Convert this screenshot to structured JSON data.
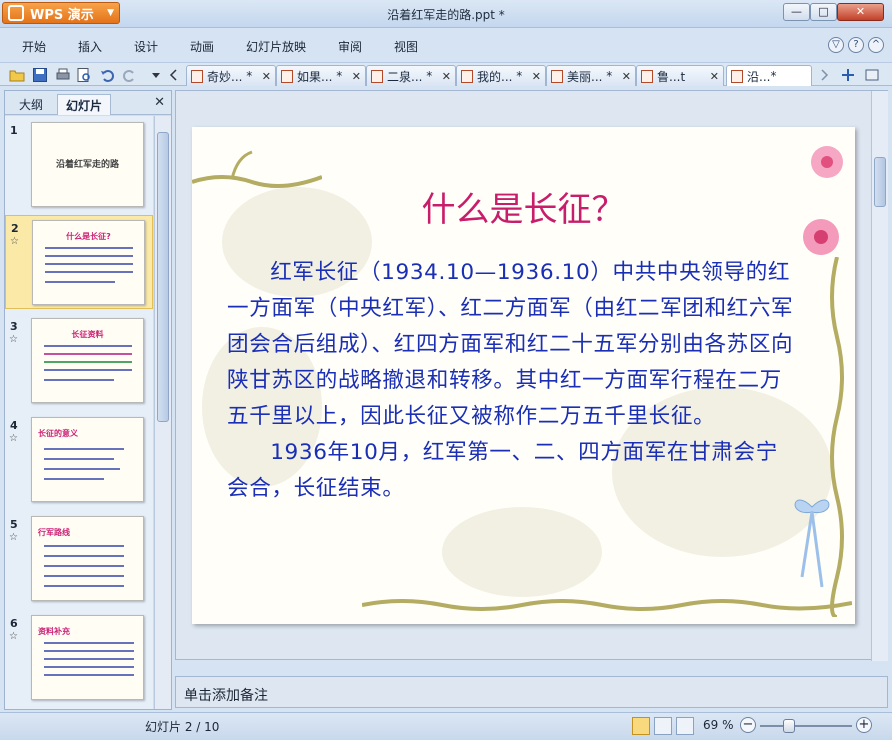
{
  "app": {
    "name": "WPS 演示",
    "window_title": "沿着红军走的路.ppt *"
  },
  "window_controls": {
    "minimize": "—",
    "maximize": "□",
    "close": "✕"
  },
  "menu": {
    "items": [
      "开始",
      "插入",
      "设计",
      "动画",
      "幻灯片放映",
      "审阅",
      "视图"
    ]
  },
  "doc_tabs": [
    {
      "label": "奇妙...",
      "modified": "*"
    },
    {
      "label": "如果...",
      "modified": "*"
    },
    {
      "label": "二泉...",
      "modified": "*"
    },
    {
      "label": "我的...",
      "modified": "*"
    },
    {
      "label": "美丽...",
      "modified": "*"
    },
    {
      "label": "鲁...t",
      "modified": ""
    },
    {
      "label": "沿...",
      "modified": "*"
    }
  ],
  "left_pane": {
    "tabs": [
      "大纲",
      "幻灯片"
    ],
    "active_tab": "幻灯片",
    "thumbnails": [
      {
        "num": "1",
        "title": "沿着红军走的路",
        "star": ""
      },
      {
        "num": "2",
        "title": "什么是长征?",
        "star": "☆"
      },
      {
        "num": "3",
        "title": "长征资料",
        "star": "☆"
      },
      {
        "num": "4",
        "title": "长征的意义",
        "star": "☆"
      },
      {
        "num": "5",
        "title": "行军路线",
        "star": "☆"
      },
      {
        "num": "6",
        "title": "资料补充",
        "star": "☆"
      }
    ],
    "selected_slide": 2
  },
  "slide": {
    "title": "什么是长征？",
    "paragraph1": "红军长征（1934.10—1936.10）中共中央领导的红一方面军（中央红军）、红二方面军（由红二军团和红六军团会合后组成）、红四方面军和红二十五军分别由各苏区向陕甘苏区的战略撤退和转移。其中红一方面军行程在二万五千里以上，因此长征又被称作二万五千里长征。",
    "paragraph2": "1936年10月，红军第一、二、四方面军在甘肃会宁会合，长征结束。"
  },
  "notes": {
    "placeholder": "单击添加备注"
  },
  "status": {
    "slide_count": "幻灯片 2 / 10",
    "zoom": "69 %"
  },
  "zoom_level": 0.69,
  "colors": {
    "title": "#c81d6a",
    "body": "#1a2fb5",
    "accent": "#e4731a"
  }
}
